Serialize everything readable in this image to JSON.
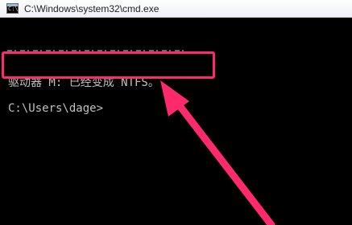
{
  "window": {
    "title": "C:\\Windows\\system32\\cmd.exe",
    "icon": "cmd-icon",
    "icon_glyph": "C:\\"
  },
  "console": {
    "lines": [
      "驱动器 M: 已经变成 NTFS。",
      "C:\\Users\\dage>"
    ],
    "text_color": "#c0c0c0",
    "background": "#000000"
  },
  "annotation": {
    "color": "#ff2a6d",
    "type": "highlight-box-with-arrow"
  }
}
